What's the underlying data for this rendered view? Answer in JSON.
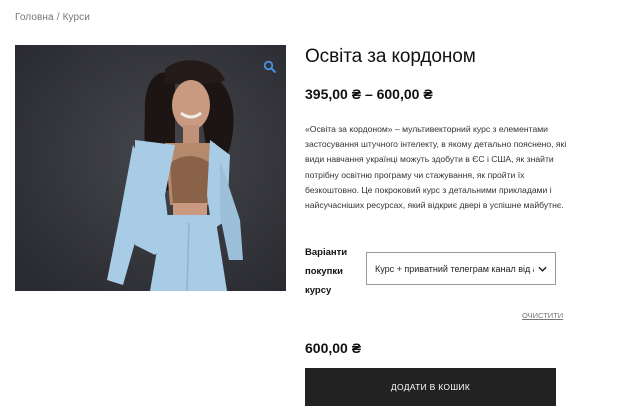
{
  "breadcrumb": {
    "home": "Головна",
    "separator": "/",
    "current": "Курси"
  },
  "product": {
    "title": "Освіта за кордоном",
    "price_range": "395,00 ₴ – 600,00 ₴",
    "description_lines": [
      "«Освіта за кордоном» – мультивекторний курс з елементами",
      "застосування штучного інтелекту, в якому детально пояснено, які",
      "види навчання українці можуть здобути в ЄС і США, як знайти",
      "потрібну освітню програму чи стажування, як пройти їх",
      "безкоштовно. Це покроковий курс з детальними прикладами і",
      "найсучасніших ресурсах, який відкриє двері в успішне майбутнє."
    ],
    "image_icon": "zoom-icon"
  },
  "variation": {
    "label_lines": [
      "Варіанти",
      "покупки",
      "курсу"
    ],
    "selected": "Курс + приватний телеграм канал від автора",
    "icon": "chevron-down-icon"
  },
  "reset_label": "ОЧИСТИТИ",
  "selected_price": "600,00 ₴",
  "cart_button_label": "ДОДАТИ В КОШИК",
  "colors": {
    "button_bg": "#222222",
    "image_bg": "#34353a",
    "jacket": "#a8cbe6"
  }
}
